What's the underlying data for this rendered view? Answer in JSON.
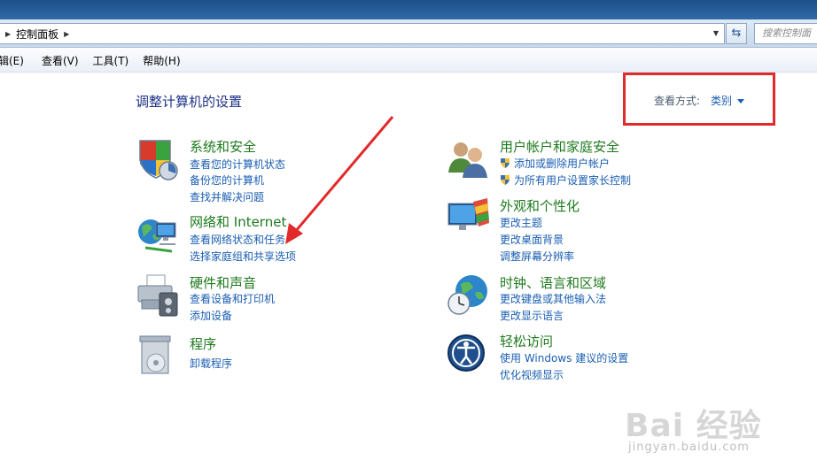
{
  "address_bar": {
    "crumb": "控制面板",
    "search_placeholder": "搜索控制面"
  },
  "menu": {
    "items": [
      "编辑(E)",
      "查看(V)",
      "工具(T)",
      "帮助(H)"
    ],
    "first_visible": "辑(E)"
  },
  "main": {
    "title": "调整计算机的设置",
    "view_by_label": "查看方式:",
    "view_by_value": "类别"
  },
  "categories": {
    "system_security": {
      "title": "系统和安全",
      "links": [
        "查看您的计算机状态",
        "备份您的计算机",
        "查找并解决问题"
      ]
    },
    "network_internet": {
      "title": "网络和 Internet",
      "links": [
        "查看网络状态和任务",
        "选择家庭组和共享选项"
      ]
    },
    "hardware_sound": {
      "title": "硬件和声音",
      "links": [
        "查看设备和打印机",
        "添加设备"
      ]
    },
    "programs": {
      "title": "程序",
      "links": [
        "卸载程序"
      ]
    },
    "user_accounts": {
      "title": "用户帐户和家庭安全",
      "links": [
        "添加或删除用户帐户",
        "为所有用户设置家长控制"
      ]
    },
    "appearance": {
      "title": "外观和个性化",
      "links": [
        "更改主题",
        "更改桌面背景",
        "调整屏幕分辨率"
      ]
    },
    "clock_language": {
      "title": "时钟、语言和区域",
      "links": [
        "更改键盘或其他输入法",
        "更改显示语言"
      ]
    },
    "ease_access": {
      "title": "轻松访问",
      "links": [
        "使用 Windows 建议的设置",
        "优化视频显示"
      ]
    }
  },
  "watermark": {
    "text": "Bai 经验",
    "url": "jingyan.baidu.com"
  },
  "colors": {
    "category_title": "#1d7a1d",
    "link": "#1a5eb2",
    "annotation": "#e12a2a"
  }
}
